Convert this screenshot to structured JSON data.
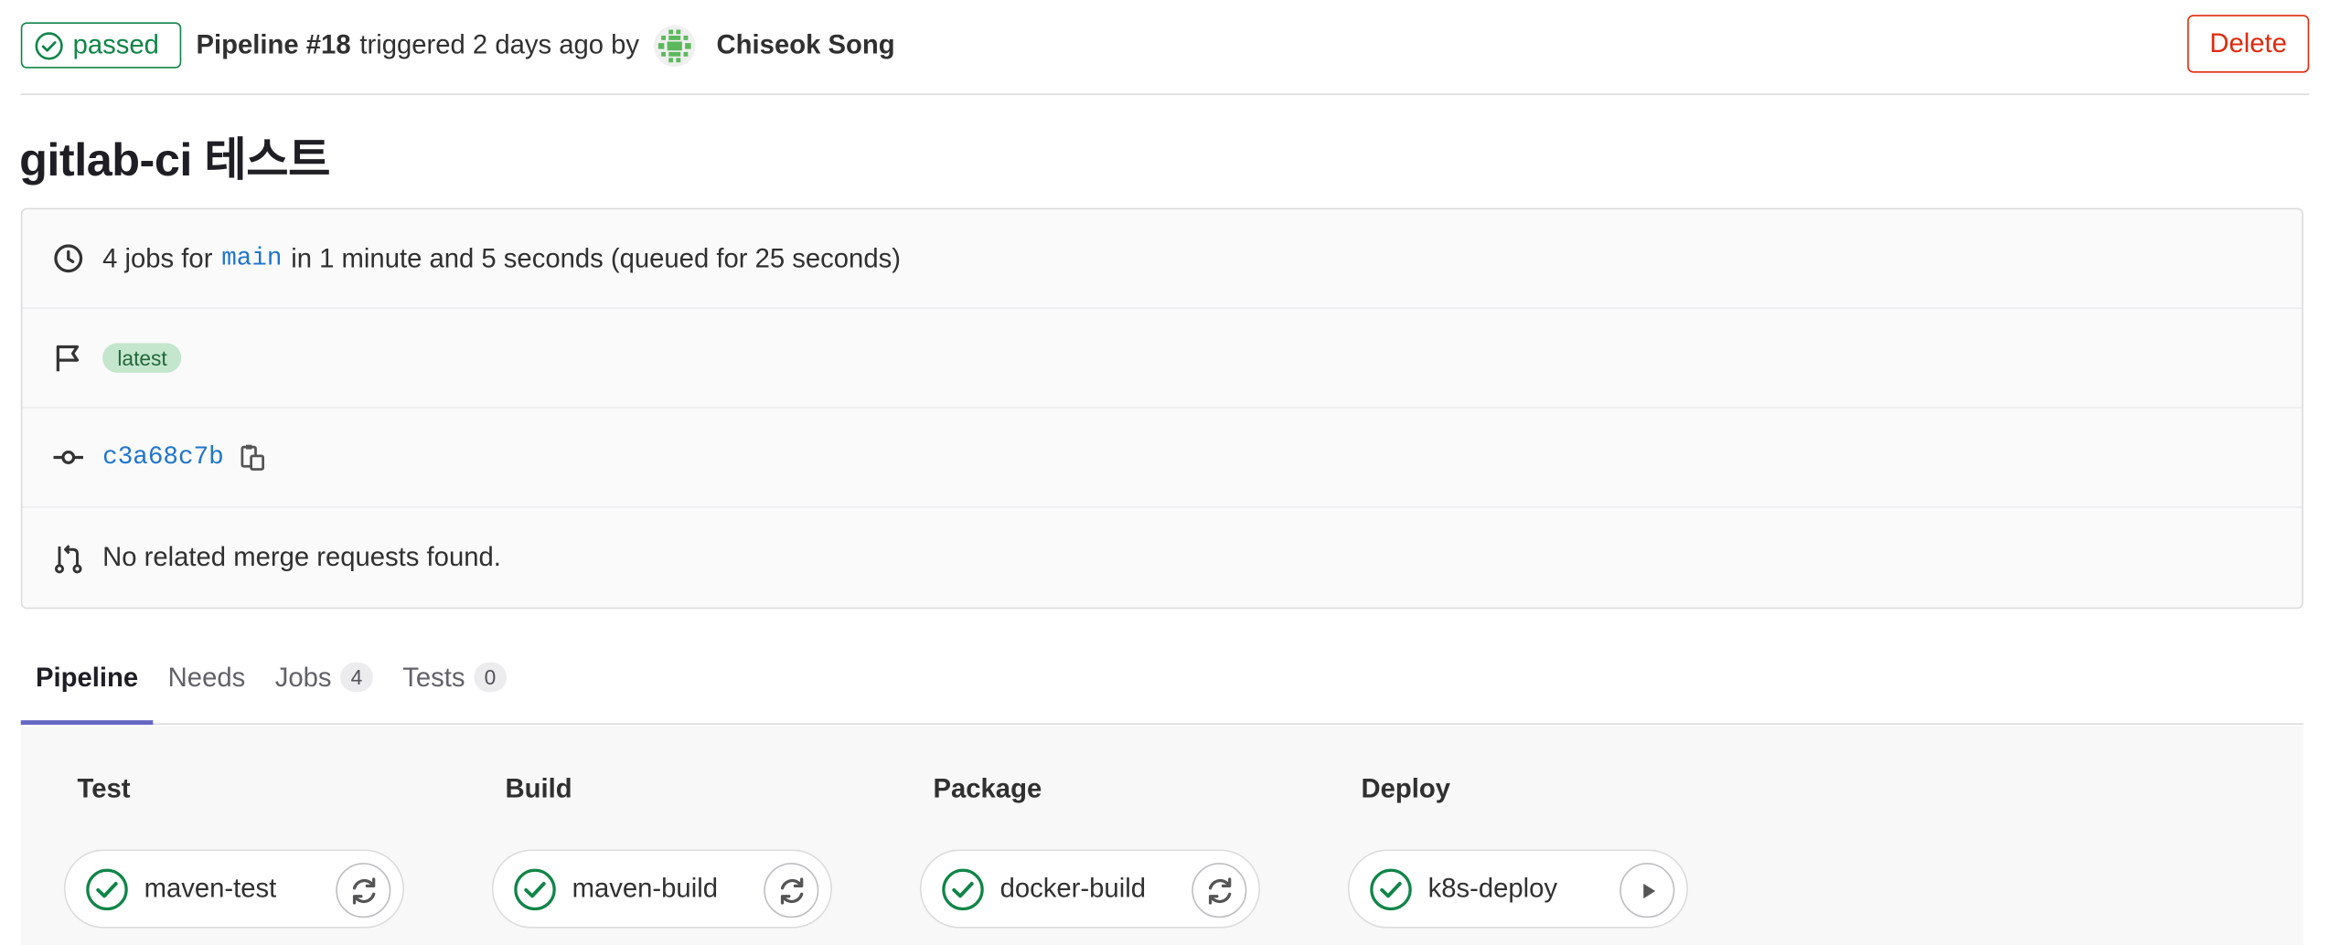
{
  "header": {
    "status": "passed",
    "pipeline_label": "Pipeline #18",
    "triggered_text": "triggered 2 days ago by",
    "user_name": "Chiseok Song",
    "delete_label": "Delete"
  },
  "title": "gitlab-ci 테스트",
  "info": {
    "jobs_prefix": "4 jobs for",
    "ref": "main",
    "jobs_suffix": "in 1 minute and 5 seconds (queued for 25 seconds)",
    "badge": "latest",
    "sha": "c3a68c7b",
    "merge_requests": "No related merge requests found."
  },
  "tabs": [
    {
      "label": "Pipeline"
    },
    {
      "label": "Needs"
    },
    {
      "label": "Jobs",
      "count": "4"
    },
    {
      "label": "Tests",
      "count": "0"
    }
  ],
  "stages": [
    {
      "title": "Test",
      "job": "maven-test",
      "action": "retry"
    },
    {
      "title": "Build",
      "job": "maven-build",
      "action": "retry"
    },
    {
      "title": "Package",
      "job": "docker-build",
      "action": "retry"
    },
    {
      "title": "Deploy",
      "job": "k8s-deploy",
      "action": "play"
    }
  ],
  "colors": {
    "success": "#108548",
    "danger": "#dd2b0e",
    "link": "#1f75cb",
    "tab_active": "#6666c4"
  }
}
